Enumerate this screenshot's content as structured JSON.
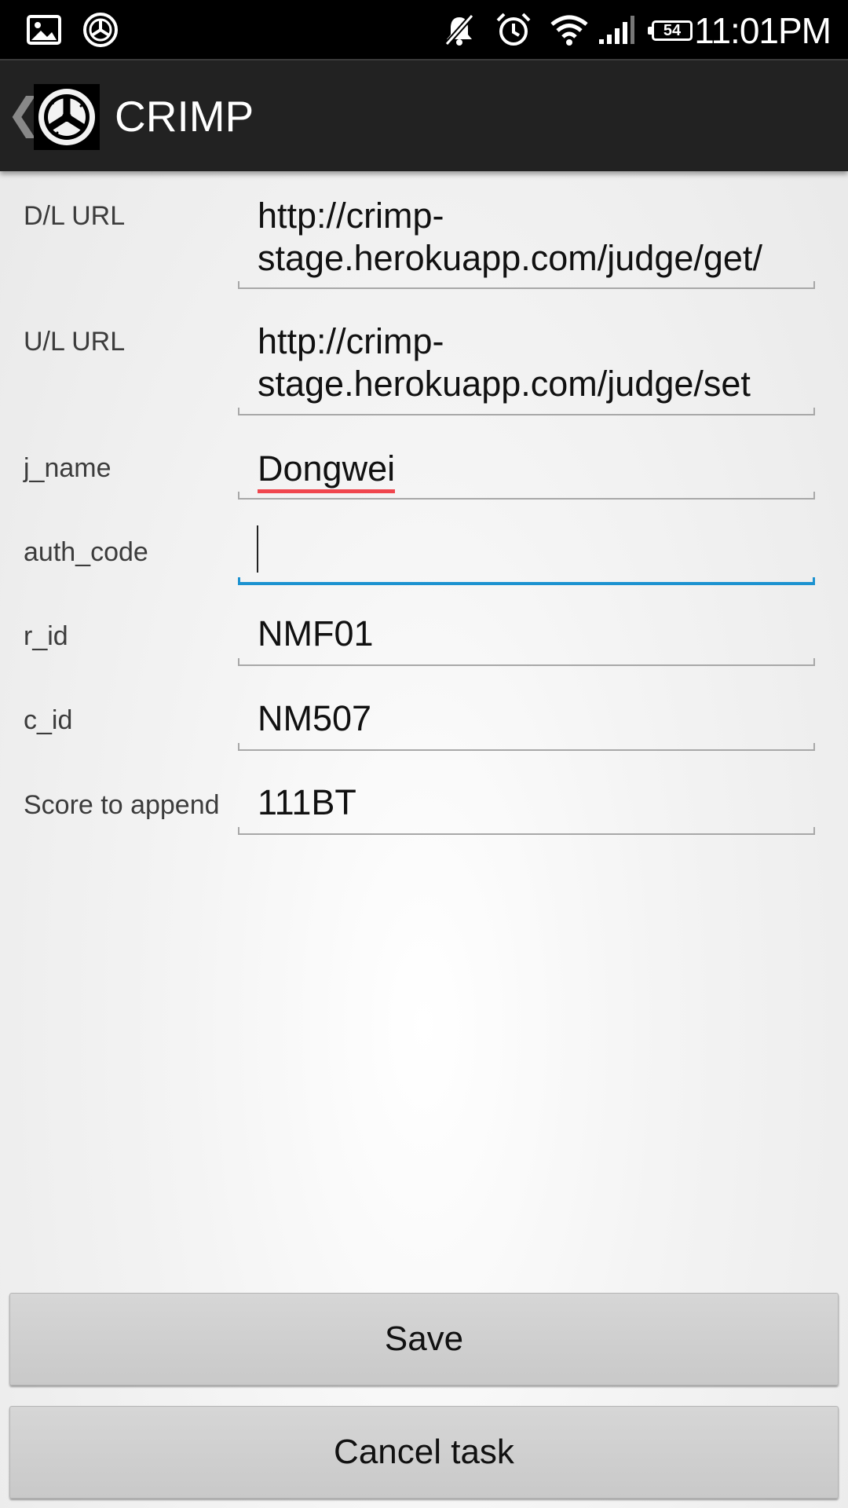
{
  "status_bar": {
    "time": "11:01PM",
    "battery_level": "54",
    "icons": [
      "gallery-icon",
      "crimp-notification-icon",
      "mute-icon",
      "alarm-icon",
      "wifi-icon",
      "signal-icon",
      "battery-icon"
    ]
  },
  "action_bar": {
    "title": "CRIMP",
    "up_indicator": "❮",
    "logo": "crimp-logo"
  },
  "form": {
    "fields": [
      {
        "label": "D/L URL",
        "value": "http://crimp-stage.herokuapp.com/judge/get/",
        "lines": [
          "http://crimp-",
          "stage.herokuapp.com/judge/get/"
        ]
      },
      {
        "label": "U/L URL",
        "value": "http://crimp-stage.herokuapp.com/judge/set",
        "lines": [
          "http://crimp-",
          "stage.herokuapp.com/judge/set"
        ]
      },
      {
        "label": "j_name",
        "value": "Dongwei"
      },
      {
        "label": "auth_code",
        "value": "",
        "focused": true
      },
      {
        "label": "r_id",
        "value": "NMF01"
      },
      {
        "label": "c_id",
        "value": "NM507"
      },
      {
        "label": "Score to append",
        "value": "111BT"
      }
    ]
  },
  "buttons": {
    "save": "Save",
    "cancel": "Cancel task"
  },
  "colors": {
    "focus_accent": "#1c92d0",
    "spellcheck_underline": "#f0464e",
    "action_bar": "#222222"
  }
}
